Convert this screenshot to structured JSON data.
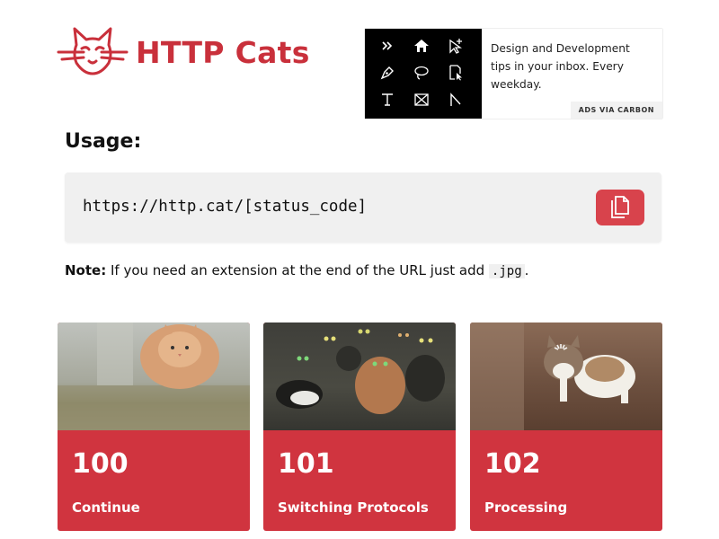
{
  "logo": {
    "title": "HTTP Cats",
    "icon": "cat-face-icon"
  },
  "ad": {
    "text": "Design and Development tips in your inbox. Every weekday.",
    "via": "ADS VIA CARBON",
    "image_icons": [
      "chevrons-icon",
      "home-icon",
      "cursor-plus-icon",
      "pen-icon",
      "lasso-icon",
      "doc-cursor-icon",
      "text-icon",
      "frame-icon",
      "slice-icon"
    ]
  },
  "usage": {
    "heading": "Usage:",
    "url": "https://http.cat/[status_code]",
    "copy_icon": "copy-icon"
  },
  "note": {
    "label": "Note:",
    "text": " If you need an extension at the end of the URL just add ",
    "ext": ".jpg",
    "end": "."
  },
  "cards": [
    {
      "code": "100",
      "label": "Continue"
    },
    {
      "code": "101",
      "label": "Switching Protocols"
    },
    {
      "code": "102",
      "label": "Processing"
    }
  ],
  "colors": {
    "brand": "#c9303b",
    "card": "#d0343f",
    "button": "#d8434c"
  }
}
